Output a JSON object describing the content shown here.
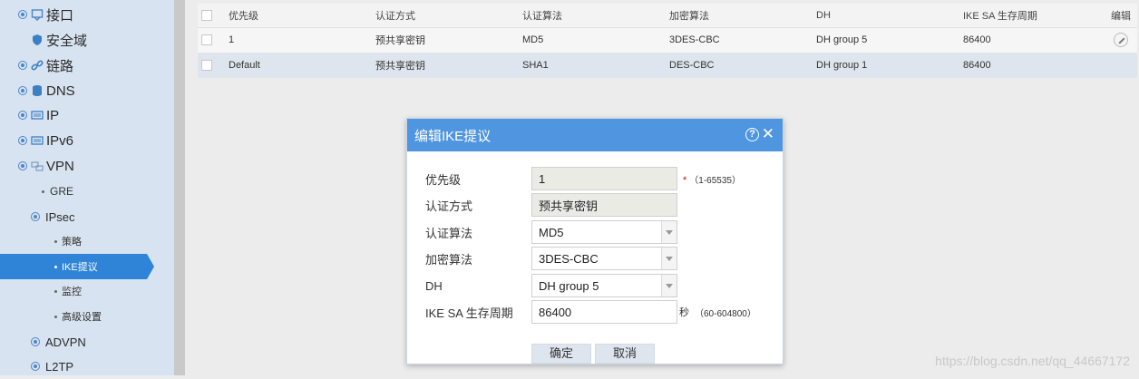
{
  "sidebar": {
    "items": [
      {
        "label": "接口",
        "icon": "interface-icon"
      },
      {
        "label": "安全域",
        "icon": "shield-icon"
      },
      {
        "label": "链路",
        "icon": "link-icon"
      },
      {
        "label": "DNS",
        "icon": "database-icon"
      },
      {
        "label": "IP",
        "icon": "network-card-icon"
      },
      {
        "label": "IPv6",
        "icon": "network-card-icon"
      },
      {
        "label": "VPN",
        "icon": "vpn-icon"
      },
      {
        "label": "GRE"
      },
      {
        "label": "IPsec"
      },
      {
        "label": "策略"
      },
      {
        "label": "IKE提议"
      },
      {
        "label": "监控"
      },
      {
        "label": "高级设置"
      },
      {
        "label": "ADVPN"
      },
      {
        "label": "L2TP"
      }
    ],
    "active": "IKE提议",
    "active_color": "#2f84d8"
  },
  "table": {
    "headers": [
      "优先级",
      "认证方式",
      "认证算法",
      "加密算法",
      "DH",
      "IKE SA 生存周期",
      "编辑"
    ],
    "rows": [
      [
        "1",
        "预共享密钥",
        "MD5",
        "3DES-CBC",
        "DH group 5",
        "86400"
      ],
      [
        "Default",
        "预共享密钥",
        "SHA1",
        "DES-CBC",
        "DH group 1",
        "86400"
      ]
    ]
  },
  "dialog": {
    "title": "编辑IKE提议",
    "header_color": "#4f95df",
    "help_glyph": "?",
    "close_glyph": "✕",
    "fields": {
      "priority": {
        "label": "优先级",
        "value": "1",
        "required_mark": "*",
        "hint": "（1-65535）"
      },
      "auth_method": {
        "label": "认证方式",
        "value": "预共享密钥"
      },
      "auth_algorithm": {
        "label": "认证算法",
        "value": "MD5"
      },
      "encryption_algorithm": {
        "label": "加密算法",
        "value": "3DES-CBC"
      },
      "dh": {
        "label": "DH",
        "value": "DH group 5"
      },
      "lifetime": {
        "label": "IKE SA 生存周期",
        "value": "86400",
        "unit": "秒",
        "hint": "（60-604800）"
      }
    },
    "ok_label": "确定",
    "cancel_label": "取消"
  },
  "watermark": "https://blog.csdn.net/qq_44667172"
}
